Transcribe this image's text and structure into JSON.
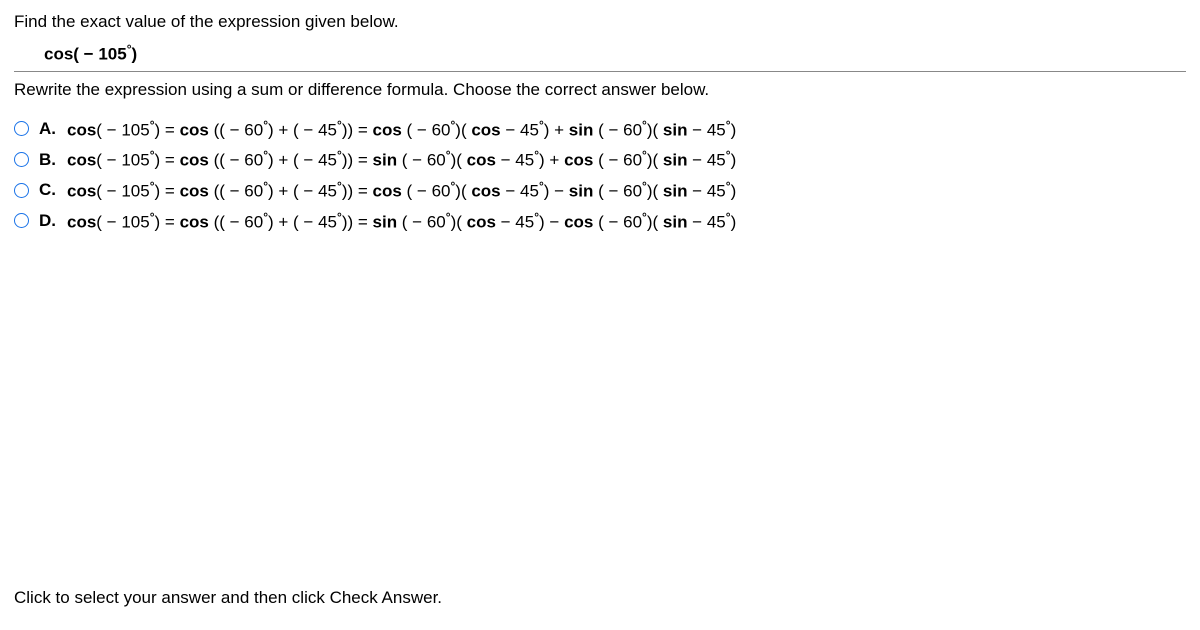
{
  "intro": "Find the exact value of the expression given below.",
  "expression_html": "cos( − 105<span class='deg'>°</span>)",
  "instruction": "Rewrite the expression using a sum or difference formula. Choose the correct answer below.",
  "choices": [
    {
      "label": "A.",
      "expr_html": "<b>cos</b>( − 105<span class='deg'>°</span>) = <b>cos</b> (( − 60<span class='deg'>°</span>) + ( − 45<span class='deg'>°</span>)) =  <b>cos</b> ( − 60<span class='deg'>°</span>)( <b>cos</b>  − 45<span class='deg'>°</span>) +  <b>sin</b> ( − 60<span class='deg'>°</span>)( <b>sin</b>  − 45<span class='deg'>°</span>)"
    },
    {
      "label": "B.",
      "expr_html": "<b>cos</b>( − 105<span class='deg'>°</span>) = <b>cos</b> (( − 60<span class='deg'>°</span>) + ( − 45<span class='deg'>°</span>)) =  <b>sin</b> ( − 60<span class='deg'>°</span>)( <b>cos</b>  − 45<span class='deg'>°</span>) +  <b>cos</b> ( − 60<span class='deg'>°</span>)( <b>sin</b>  − 45<span class='deg'>°</span>)"
    },
    {
      "label": "C.",
      "expr_html": "<b>cos</b>( − 105<span class='deg'>°</span>) = <b>cos</b> (( − 60<span class='deg'>°</span>) + ( − 45<span class='deg'>°</span>)) =  <b>cos</b> ( − 60<span class='deg'>°</span>)( <b>cos</b>  − 45<span class='deg'>°</span>) −  <b>sin</b> ( − 60<span class='deg'>°</span>)( <b>sin</b>  − 45<span class='deg'>°</span>)"
    },
    {
      "label": "D.",
      "expr_html": "<b>cos</b>( − 105<span class='deg'>°</span>) = <b>cos</b> (( − 60<span class='deg'>°</span>) + ( − 45<span class='deg'>°</span>)) =  <b>sin</b> ( − 60<span class='deg'>°</span>)( <b>cos</b>  − 45<span class='deg'>°</span>) −  <b>cos</b> ( − 60<span class='deg'>°</span>)( <b>sin</b>  − 45<span class='deg'>°</span>)"
    }
  ],
  "footer": "Click to select your answer and then click Check Answer."
}
